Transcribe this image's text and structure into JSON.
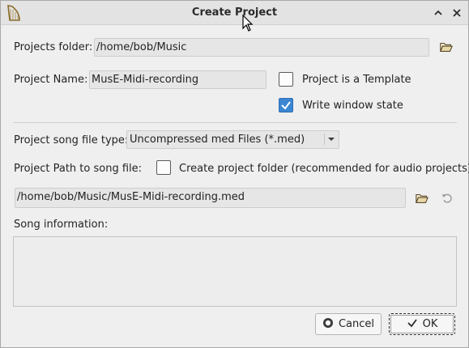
{
  "window": {
    "title": "Create Project"
  },
  "form": {
    "projects_folder_label": "Projects folder:",
    "projects_folder_value": "/home/bob/Music",
    "project_name_label": "Project Name:",
    "project_name_value": "MusE-Midi-recording",
    "template_checkbox_label": "Project is a Template",
    "template_checked": false,
    "write_window_state_label": "Write window state",
    "write_window_state_checked": true,
    "song_file_type_label": "Project song file type:",
    "song_file_type_value": "Uncompressed med Files (*.med)",
    "path_to_song_label": "Project Path to song file:",
    "create_folder_label": "Create project folder (recommended for audio projects)",
    "create_folder_checked": false,
    "song_path_value": "/home/bob/Music/MusE-Midi-recording.med",
    "song_info_label": "Song information:",
    "song_info_value": ""
  },
  "buttons": {
    "cancel": "Cancel",
    "ok": "OK"
  },
  "icons": {
    "app": "harp-icon",
    "minimize": "chevron-up-icon",
    "close": "close-icon",
    "folder_open": "folder-open-icon",
    "reset": "undo-icon",
    "cancel": "cancel-icon",
    "ok": "checkmark-icon"
  },
  "colors": {
    "checkbox_checked": "#3b86d3",
    "folder_icon": "#5a4a2a"
  }
}
